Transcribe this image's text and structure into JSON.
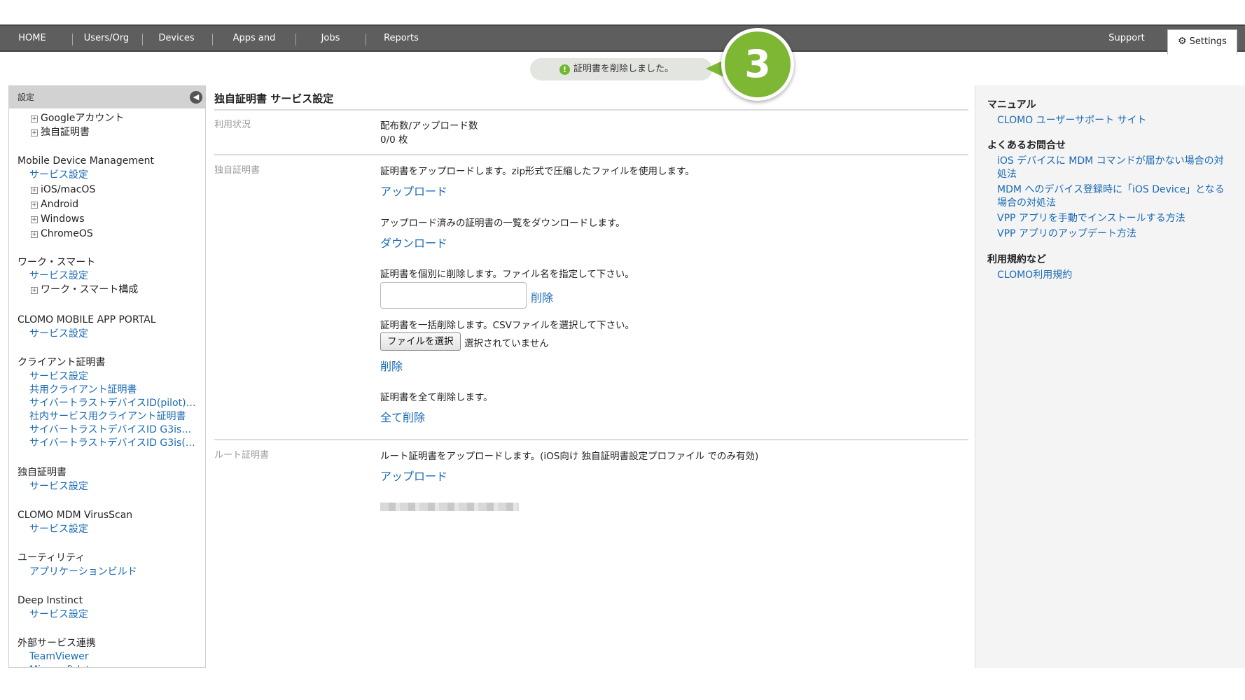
{
  "nav": {
    "items": [
      "HOME",
      "Users/Org",
      "Devices",
      "Apps and Books",
      "Jobs",
      "Reports"
    ],
    "support": "Support",
    "settings": "Settings"
  },
  "toast": {
    "message": "証明書を削除しました。",
    "step_number": "3"
  },
  "sidebar": {
    "header": "設定",
    "entries": [
      {
        "kind": "e",
        "text": "Googleアカウント"
      },
      {
        "kind": "e",
        "text": "独自証明書"
      },
      {
        "kind": "h",
        "text": "Mobile Device Management"
      },
      {
        "kind": "l",
        "text": "サービス設定"
      },
      {
        "kind": "e",
        "text": "iOS/macOS"
      },
      {
        "kind": "e",
        "text": "Android"
      },
      {
        "kind": "e",
        "text": "Windows"
      },
      {
        "kind": "e",
        "text": "ChromeOS"
      },
      {
        "kind": "h",
        "text": "ワーク・スマート"
      },
      {
        "kind": "l",
        "text": "サービス設定"
      },
      {
        "kind": "e",
        "text": "ワーク・スマート構成"
      },
      {
        "kind": "h",
        "text": "CLOMO MOBILE APP PORTAL"
      },
      {
        "kind": "l",
        "text": "サービス設定"
      },
      {
        "kind": "h",
        "text": "クライアント証明書"
      },
      {
        "kind": "l",
        "text": "サービス設定"
      },
      {
        "kind": "l",
        "text": "共用クライアント証明書"
      },
      {
        "kind": "l",
        "text": "サイバートラストデバイスID(pilot)…"
      },
      {
        "kind": "l",
        "text": "社内サービス用クライアント証明書"
      },
      {
        "kind": "l",
        "text": "サイバートラストデバイスID G3is…"
      },
      {
        "kind": "l",
        "text": "サイバートラストデバイスID G3is(…"
      },
      {
        "kind": "h",
        "text": "独自証明書"
      },
      {
        "kind": "l",
        "text": "サービス設定"
      },
      {
        "kind": "h",
        "text": "CLOMO MDM VirusScan"
      },
      {
        "kind": "l",
        "text": "サービス設定"
      },
      {
        "kind": "h",
        "text": "ユーティリティ"
      },
      {
        "kind": "l",
        "text": "アプリケーションビルド"
      },
      {
        "kind": "h",
        "text": "Deep Instinct"
      },
      {
        "kind": "l",
        "text": "サービス設定"
      },
      {
        "kind": "h",
        "text": "外部サービス連携"
      },
      {
        "kind": "l",
        "text": "TeamViewer"
      },
      {
        "kind": "l",
        "text": "Microsoft Intune"
      }
    ]
  },
  "main": {
    "title": "独自証明書 サービス設定",
    "usage_label": "利用状況",
    "usage_desc": "配布数/アップロード数",
    "usage_value": "0/0 枚",
    "cert_label": "独自証明書",
    "upload_desc": "証明書をアップロードします。zip形式で圧縮したファイルを使用します。",
    "upload_link": "アップロード",
    "download_desc": "アップロード済みの証明書の一覧をダウンロードします。",
    "download_link": "ダウンロード",
    "delete_single_desc": "証明書を個別に削除します。ファイル名を指定して下さい。",
    "delete_single_link": "削除",
    "delete_csv_desc": "証明書を一括削除します。CSVファイルを選択して下さい。",
    "choose_file": "ファイルを選択",
    "no_file": "選択されていません",
    "delete_csv_link": "削除",
    "delete_all_desc": "証明書を全て削除します。",
    "delete_all_link": "全て削除",
    "root_label": "ルート証明書",
    "root_desc": "ルート証明書をアップロードします。(iOS向け 独自証明書設定プロファイル でのみ有効)",
    "root_link": "アップロード"
  },
  "right_panel": {
    "manual_heading": "マニュアル",
    "manual_link": "CLOMO ユーザーサポート サイト",
    "faq_heading": "よくあるお問合せ",
    "faq_links": [
      "iOS デバイスに MDM コマンドが届かない場合の対処法",
      "MDM へのデバイス登録時に「iOS Device」となる場合の対処法",
      "VPP アプリを手動でインストールする方法",
      "VPP アプリのアップデート方法"
    ],
    "terms_heading": "利用規約など",
    "terms_link": "CLOMO利用規約"
  },
  "colors": {
    "accent_link": "#1a6ab3",
    "nav_bg": "#5e5e5e",
    "step_badge": "#7db733"
  }
}
